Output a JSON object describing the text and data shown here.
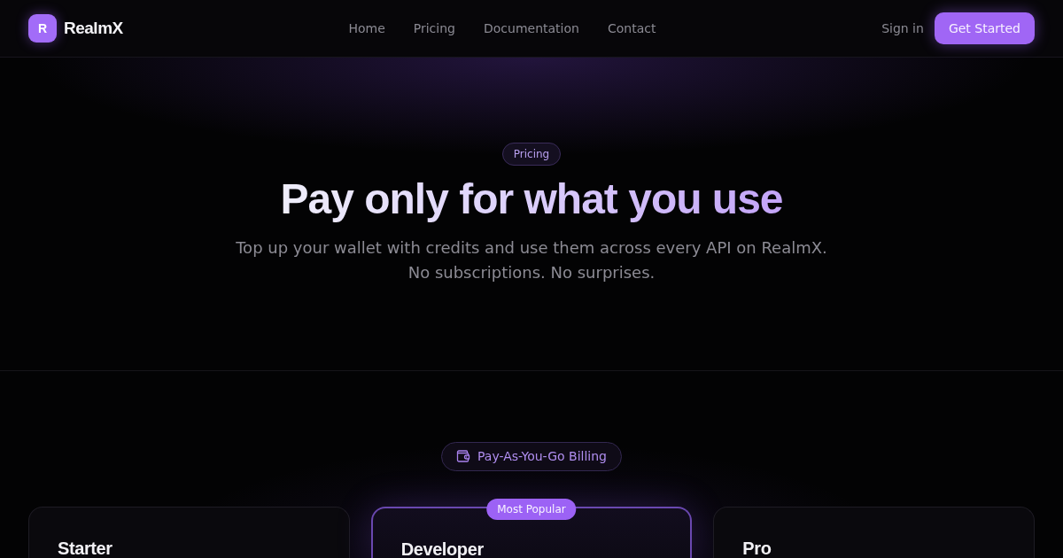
{
  "nav": {
    "brand": {
      "logo_letter": "R",
      "name": "RealmX"
    },
    "links": [
      {
        "label": "Home"
      },
      {
        "label": "Pricing"
      },
      {
        "label": "Documentation"
      },
      {
        "label": "Contact"
      }
    ],
    "sign_in": "Sign in",
    "cta": "Get Started"
  },
  "hero": {
    "badge": "Pricing",
    "title": "Pay only for what you use",
    "subtitle_lines": [
      "Top up your wallet with credits and use them across every API on RealmX.",
      "No subscriptions. No surprises."
    ]
  },
  "billing": {
    "badge": "Pay-As-You-Go Billing"
  },
  "plans": [
    {
      "name": "Starter",
      "featured": false
    },
    {
      "name": "Developer",
      "featured": true,
      "ribbon": "Most Popular"
    },
    {
      "name": "Pro",
      "featured": false
    }
  ]
}
